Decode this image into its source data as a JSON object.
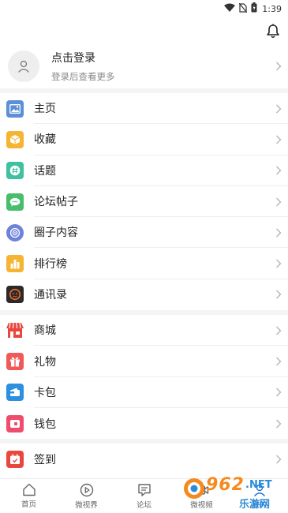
{
  "status": {
    "time": "1:39"
  },
  "login": {
    "title": "点击登录",
    "subtitle": "登录后查看更多"
  },
  "groups": [
    [
      {
        "label": "主页",
        "icon": "image-icon",
        "color": "#5c8fd6"
      },
      {
        "label": "收藏",
        "icon": "box-icon",
        "color": "#f5b431"
      },
      {
        "label": "话题",
        "icon": "hashtag-icon",
        "color": "#3fc0a1"
      },
      {
        "label": "论坛帖子",
        "icon": "chat-icon",
        "color": "#48be6c"
      },
      {
        "label": "圈子内容",
        "icon": "target-icon",
        "color": "#6f82d9"
      },
      {
        "label": "排行榜",
        "icon": "bar-chart-icon",
        "color": "#f5b431"
      },
      {
        "label": "通讯录",
        "icon": "contacts-icon",
        "color": "#2a2a2a"
      }
    ],
    [
      {
        "label": "商城",
        "icon": "store-icon",
        "color": "#e9473d"
      },
      {
        "label": "礼物",
        "icon": "gift-icon",
        "color": "#ef5a58"
      },
      {
        "label": "卡包",
        "icon": "card-wallet-icon",
        "color": "#2d8fe0"
      },
      {
        "label": "钱包",
        "icon": "wallet-icon",
        "color": "#ef4d6d"
      }
    ],
    [
      {
        "label": "签到",
        "icon": "calendar-icon",
        "color": "#e9473d"
      }
    ]
  ],
  "tabs": [
    {
      "label": "首页",
      "icon": "home-icon"
    },
    {
      "label": "微视界",
      "icon": "play-icon"
    },
    {
      "label": "论坛",
      "icon": "forum-icon"
    },
    {
      "label": "微视频",
      "icon": "video-icon"
    },
    {
      "label": "我的",
      "icon": "user-icon",
      "active": true
    }
  ],
  "watermark": {
    "number": "962",
    "net": ".NET",
    "sub": "乐游网"
  }
}
